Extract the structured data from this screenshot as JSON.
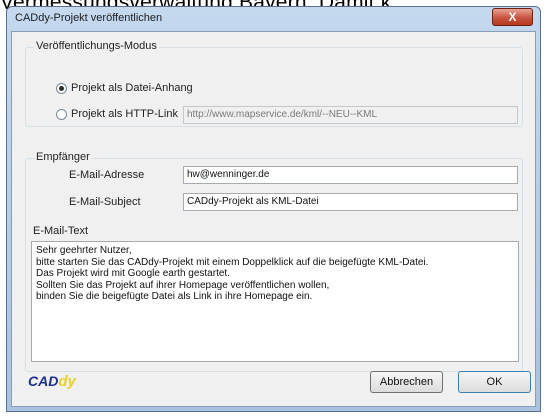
{
  "background_text": "Vermessungsverwaltung Bayern. Damit k",
  "window": {
    "title": "CADdy-Projekt veröffentlichen",
    "close_glyph": "X"
  },
  "mode_group": {
    "label": "Veröffentlichungs-Modus",
    "attachment_label": "Projekt als Datei-Anhang",
    "attachment_checked": true,
    "link_label": "Projekt als HTTP-Link",
    "link_checked": false,
    "link_url": "http://www.mapservice.de/kml/--NEU--KML"
  },
  "recipient_group": {
    "label": "Empfänger",
    "email_label": "E-Mail-Adresse",
    "email_value": "hw@wenninger.de",
    "subject_label": "E-Mail-Subject",
    "subject_value": "CADdy-Projekt als KML-Datei",
    "body_label": "E-Mail-Text",
    "body_lines": [
      "Sehr geehrter Nutzer,",
      "bitte starten Sie das CADdy-Projekt mit einem Doppelklick auf die beigefügte KML-Datei.",
      "Das Projekt wird mit Google earth gestartet.",
      "Sollten Sie das Projekt auf ihrer Homepage veröffentlichen wollen,",
      "binden Sie die beigefügte Datei als Link in ihre Homepage ein."
    ]
  },
  "buttons": {
    "cancel": "Abbrechen",
    "ok": "OK"
  },
  "logo": {
    "part1": "CAD",
    "part2": "dy"
  }
}
